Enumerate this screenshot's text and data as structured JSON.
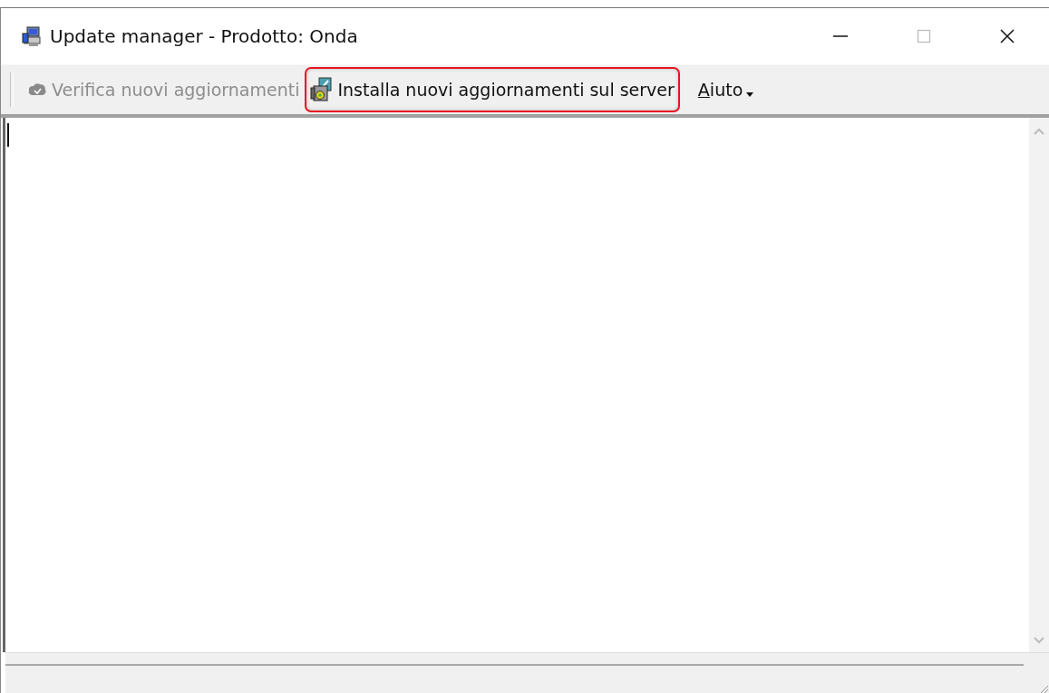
{
  "window": {
    "title": "Update manager - Prodotto: Onda"
  },
  "toolbar": {
    "items": [
      {
        "kind": "button",
        "label": "Verifica nuovi aggiornamenti",
        "disabled": true,
        "highlighted": false
      },
      {
        "kind": "button",
        "label": "Installa nuovi aggiornamenti sul server",
        "disabled": false,
        "highlighted": true
      },
      {
        "kind": "menu",
        "label": "Aiuto",
        "disabled": false,
        "highlighted": false
      }
    ]
  },
  "log": {
    "text_cursor": true
  }
}
